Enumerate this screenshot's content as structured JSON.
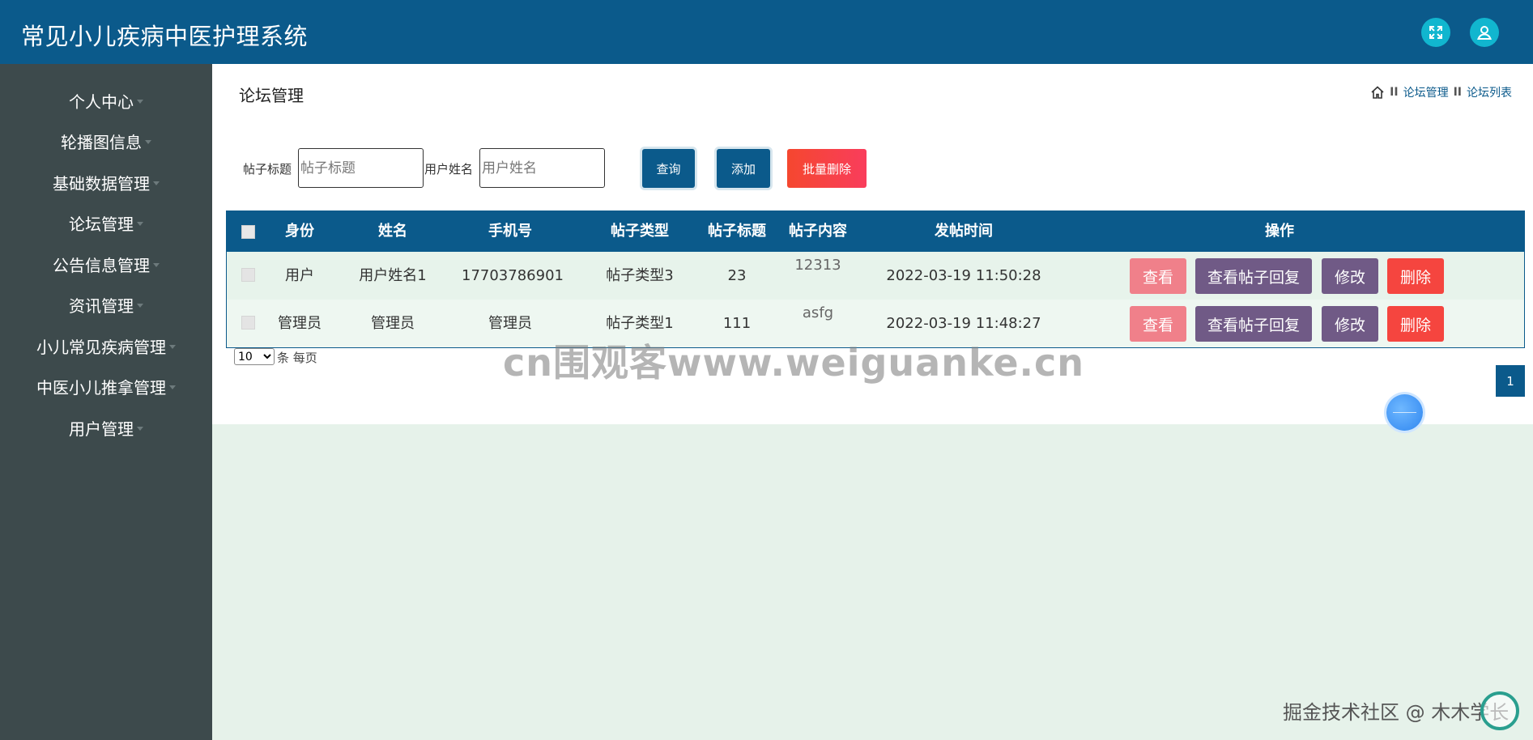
{
  "app": {
    "title": "常见小儿疾病中医护理系统"
  },
  "header": {
    "icons": [
      "expand-icon",
      "user-icon"
    ]
  },
  "sidebar": {
    "items": [
      {
        "label": "个人中心"
      },
      {
        "label": "轮播图信息"
      },
      {
        "label": "基础数据管理"
      },
      {
        "label": "论坛管理"
      },
      {
        "label": "公告信息管理"
      },
      {
        "label": "资讯管理"
      },
      {
        "label": "小儿常见疾病管理"
      },
      {
        "label": "中医小儿推拿管理"
      },
      {
        "label": "用户管理"
      }
    ]
  },
  "page": {
    "title": "论坛管理",
    "breadcrumb": [
      "论坛管理",
      "论坛列表"
    ],
    "breadcrumb_sep": "II"
  },
  "search": {
    "title_label": "帖子标题",
    "title_placeholder": "帖子标题",
    "user_label": "用户姓名",
    "user_placeholder": "用户姓名",
    "query_label": "查询",
    "add_label": "添加",
    "batch_delete_label": "批量删除"
  },
  "table": {
    "columns": [
      "身份",
      "姓名",
      "手机号",
      "帖子类型",
      "帖子标题",
      "帖子内容",
      "发帖时间",
      "操作"
    ],
    "rows": [
      {
        "role": "用户",
        "name": "用户姓名1",
        "phone": "17703786901",
        "type": "帖子类型3",
        "title": "23",
        "content": "12313",
        "time": "2022-03-19 11:50:28"
      },
      {
        "role": "管理员",
        "name": "管理员",
        "phone": "管理员",
        "type": "帖子类型1",
        "title": "111",
        "content": "asfg",
        "time": "2022-03-19 11:48:27"
      }
    ],
    "actions": {
      "view": "查看",
      "view_replies": "查看帖子回复",
      "edit": "修改",
      "delete": "删除"
    }
  },
  "pagination": {
    "page_size": "10",
    "page_size_options": [
      "10"
    ],
    "page_size_suffix": "条 每页",
    "current_page": "1"
  },
  "overlay": {
    "watermark": "cn围观客www.weiguanke.cn",
    "credit": "掘金技术社区 @ 木木学长"
  },
  "colors": {
    "primary": "#0b5a8b",
    "sidebar": "#3d4a4c",
    "accent_cyan": "#11b6cf",
    "danger": "#f5453f",
    "view": "#f0808a",
    "purple": "#705a86",
    "background": "#e6f2ea"
  }
}
